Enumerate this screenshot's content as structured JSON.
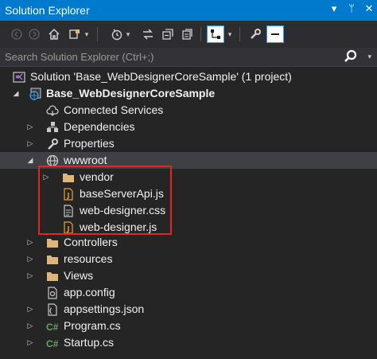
{
  "panel": {
    "title": "Solution Explorer",
    "title_icons": [
      "dropdown-icon",
      "pin-icon",
      "close-icon"
    ],
    "title_glyphs": {
      "dropdown": "▾",
      "pin": "ᛘ",
      "close": "✕"
    }
  },
  "toolbar": {
    "buttons": [
      "back-icon",
      "forward-icon",
      "home-icon",
      "switch-views-icon",
      "pending-changes-icon",
      "sync-icon",
      "collapse-all-icon",
      "show-all-files-icon",
      "preview-icon",
      "properties-icon",
      "minus-icon"
    ]
  },
  "search": {
    "placeholder": "Search Solution Explorer (Ctrl+;)"
  },
  "tree": {
    "solution": "Solution 'Base_WebDesignerCoreSample' (1 project)",
    "project": "Base_WebDesignerCoreSample",
    "items": [
      {
        "label": "Connected Services",
        "icon": "connected-services-icon"
      },
      {
        "label": "Dependencies",
        "icon": "dependencies-icon"
      },
      {
        "label": "Properties",
        "icon": "wrench-icon"
      },
      {
        "label": "wwwroot",
        "icon": "globe-icon"
      },
      {
        "label": "vendor",
        "icon": "folder-icon"
      },
      {
        "label": "baseServerApi.js",
        "icon": "js-file-icon"
      },
      {
        "label": "web-designer.css",
        "icon": "css-file-icon"
      },
      {
        "label": "web-designer.js",
        "icon": "js-file-icon"
      },
      {
        "label": "Controllers",
        "icon": "folder-icon"
      },
      {
        "label": "resources",
        "icon": "folder-icon"
      },
      {
        "label": "Views",
        "icon": "folder-icon"
      },
      {
        "label": "app.config",
        "icon": "config-file-icon"
      },
      {
        "label": "appsettings.json",
        "icon": "json-file-icon"
      },
      {
        "label": "Program.cs",
        "icon": "csharp-file-icon"
      },
      {
        "label": "Startup.cs",
        "icon": "csharp-file-icon"
      }
    ]
  },
  "colors": {
    "accent": "#007acc",
    "highlight_box": "#e0262b",
    "folder": "#dcb67a",
    "csharp": "#68a063",
    "js": "#f0a030"
  }
}
